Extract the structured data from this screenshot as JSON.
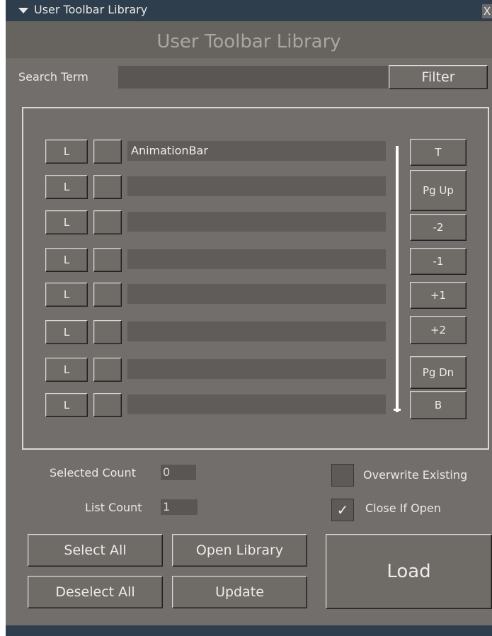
{
  "window": {
    "title": "User Toolbar Library",
    "close_glyph": "X"
  },
  "header": {
    "title": "User Toolbar Library"
  },
  "search": {
    "label": "Search Term",
    "value": "",
    "filter_label": "Filter"
  },
  "list": {
    "load_label": "L",
    "rows": [
      {
        "name": "AnimationBar",
        "selected": false
      },
      {
        "name": "",
        "selected": false
      },
      {
        "name": "",
        "selected": false
      },
      {
        "name": "",
        "selected": false
      },
      {
        "name": "",
        "selected": false
      },
      {
        "name": "",
        "selected": false
      },
      {
        "name": "",
        "selected": false
      },
      {
        "name": "",
        "selected": false
      }
    ],
    "nav": [
      "T",
      "Pg Up",
      "-2",
      "-1",
      "+1",
      "+2",
      "Pg Dn",
      "B"
    ]
  },
  "counts": {
    "selected_label": "Selected Count",
    "selected_value": "0",
    "list_label": "List Count",
    "list_value": "1"
  },
  "options": {
    "overwrite_label": "Overwrite Existing",
    "overwrite_checked": false,
    "close_label": "Close If Open",
    "close_checked": true,
    "check_glyph": "✓"
  },
  "actions": {
    "select_all": "Select All",
    "deselect_all": "Deselect All",
    "open_library": "Open Library",
    "update": "Update",
    "load": "Load"
  }
}
